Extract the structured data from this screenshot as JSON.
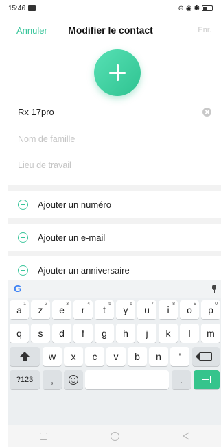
{
  "status_bar": {
    "time": "15:46",
    "icons": [
      "image-icon",
      "signal-icon",
      "nfc-icon",
      "bluetooth-icon",
      "battery-icon"
    ]
  },
  "header": {
    "cancel_label": "Annuler",
    "title": "Modifier le contact",
    "save_label": "Enr."
  },
  "avatar": {
    "icon": "add-photo-plus-icon",
    "accent_color": "#37c59a"
  },
  "fields": {
    "first_name_value": "Rx 17pro",
    "last_name_placeholder": "Nom de famille",
    "company_placeholder": "Lieu de travail"
  },
  "actions": {
    "add_number": "Ajouter un numéro",
    "add_email": "Ajouter un e-mail",
    "add_birthday": "Ajouter un anniversaire"
  },
  "keyboard": {
    "brand_icon": "google-g-icon",
    "mic_icon": "microphone-icon",
    "row1": [
      "a",
      "z",
      "e",
      "r",
      "t",
      "y",
      "u",
      "i",
      "o",
      "p"
    ],
    "row1_numbers": [
      "1",
      "2",
      "3",
      "4",
      "5",
      "6",
      "7",
      "8",
      "9",
      "0"
    ],
    "row2": [
      "q",
      "s",
      "d",
      "f",
      "g",
      "h",
      "j",
      "k",
      "l",
      "m"
    ],
    "row3": [
      "w",
      "x",
      "c",
      "v",
      "b",
      "n",
      "'"
    ],
    "symbols_key": "?123",
    "comma_key": ",",
    "period_key": ".",
    "enter_color": "#35c48c"
  },
  "nav_bar": {
    "icons": [
      "recent-apps-icon",
      "home-icon",
      "back-icon"
    ]
  }
}
